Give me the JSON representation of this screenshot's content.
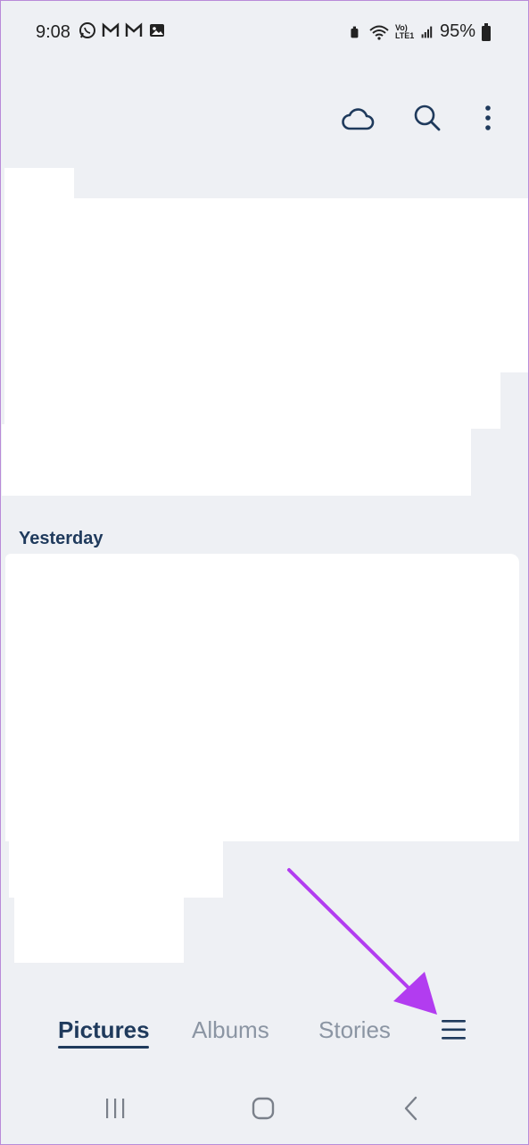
{
  "status_bar": {
    "time": "9:08",
    "battery_percent": "95%",
    "network_label": "Vo) LTE1",
    "left_icons": [
      "whatsapp-icon",
      "gmail-icon",
      "gmail-icon",
      "gallery-icon"
    ],
    "right_icons": [
      "clean-icon",
      "wifi-icon",
      "signal-icon",
      "battery-icon"
    ]
  },
  "toolbar": {
    "icons": [
      "cloud-icon",
      "search-icon",
      "more-options-icon"
    ]
  },
  "content": {
    "section_label": "Yesterday"
  },
  "bottom_nav": {
    "tabs": [
      {
        "label": "Pictures",
        "active": true
      },
      {
        "label": "Albums",
        "active": false
      },
      {
        "label": "Stories",
        "active": false
      }
    ],
    "menu_icon": "hamburger-menu-icon"
  },
  "system_nav": {
    "icons": [
      "recent-apps-icon",
      "home-icon",
      "back-icon"
    ]
  },
  "colors": {
    "background": "#eef0f4",
    "text_primary": "#1f3a5c",
    "text_inactive": "#8b95a3",
    "annotation_arrow": "#b23cf0"
  }
}
